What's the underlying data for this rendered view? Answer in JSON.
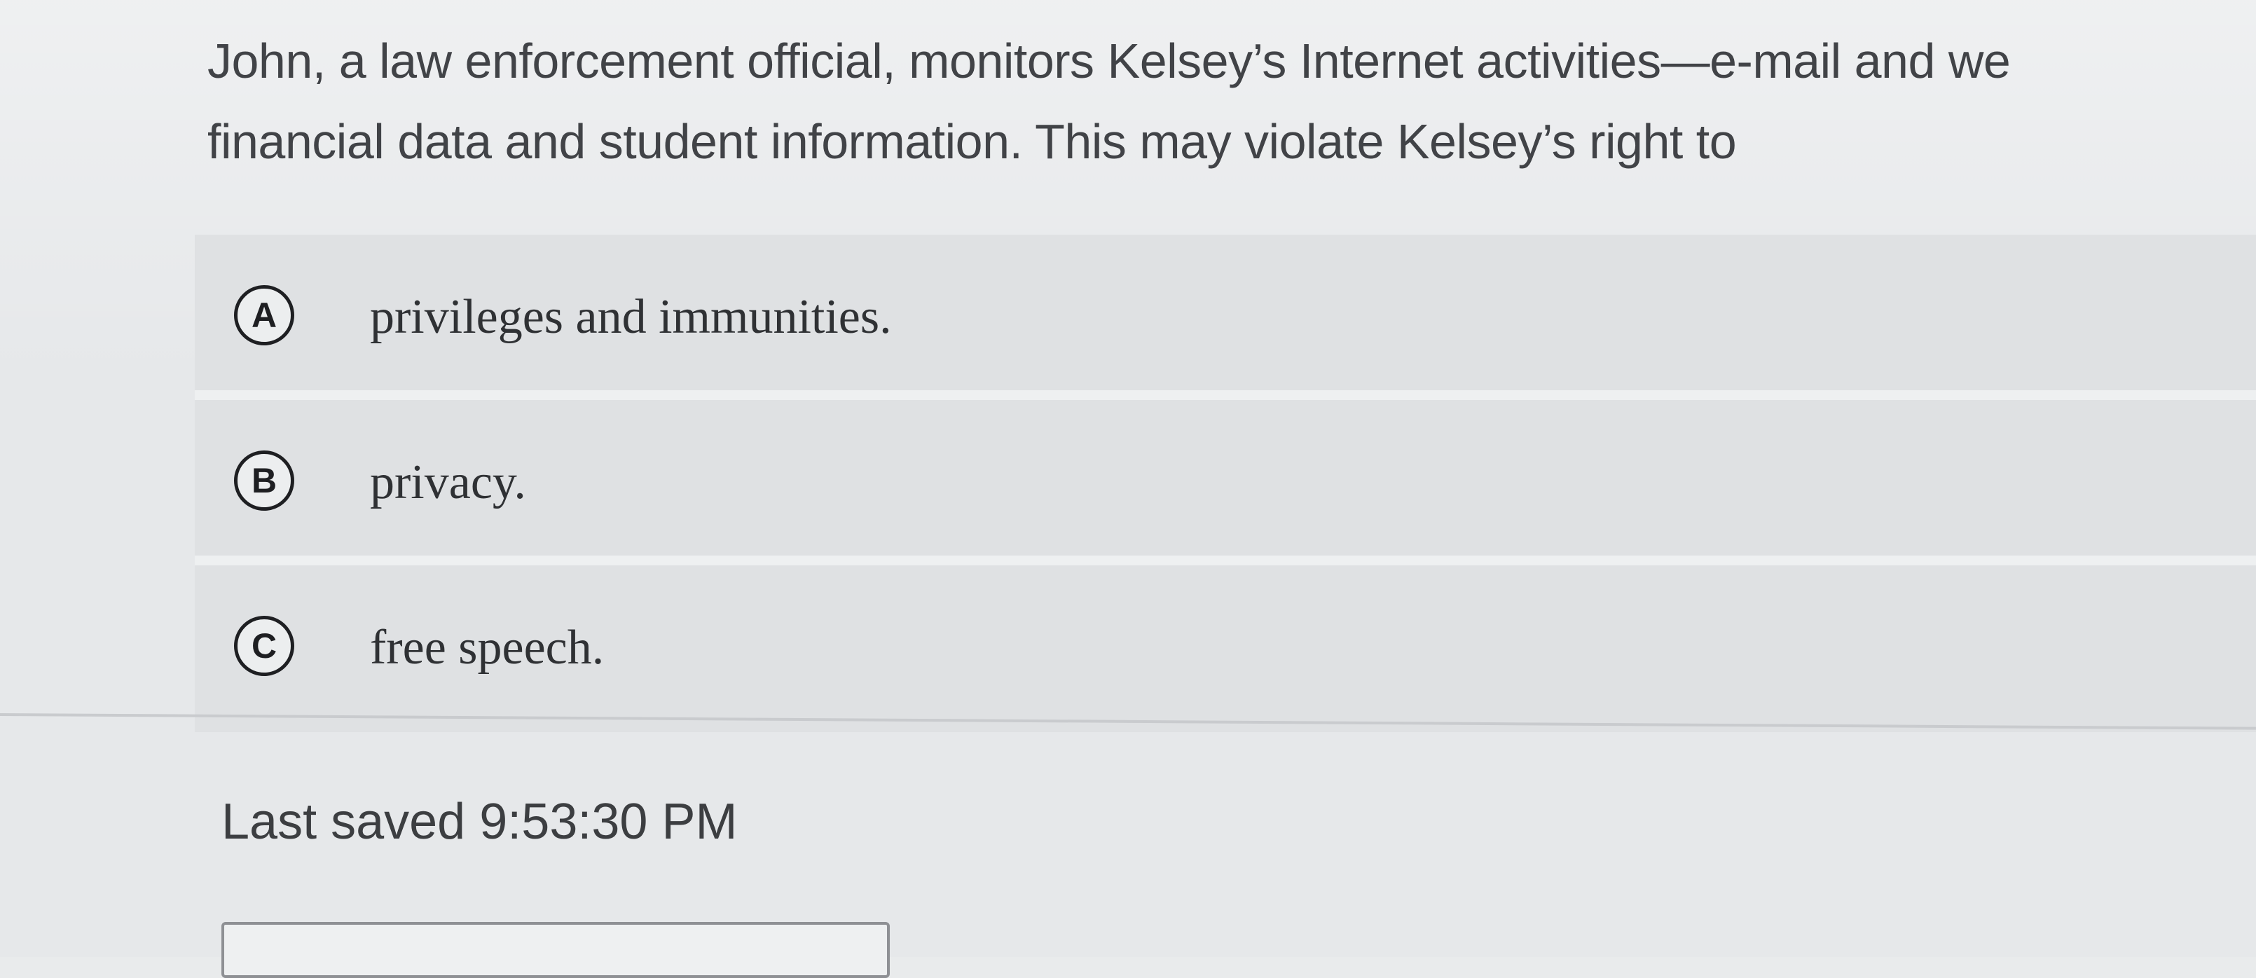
{
  "question": {
    "line1": "John, a law enforcement official, monitors Kelsey’s Internet activities—e-mail and we",
    "line2": "financial data and student information. This may violate Kelsey’s right to"
  },
  "choices": [
    {
      "letter": "A",
      "text": "privileges and immunities."
    },
    {
      "letter": "B",
      "text": "privacy."
    },
    {
      "letter": "C",
      "text": "free speech."
    }
  ],
  "status": {
    "last_saved": "Last saved 9:53:30 PM"
  }
}
